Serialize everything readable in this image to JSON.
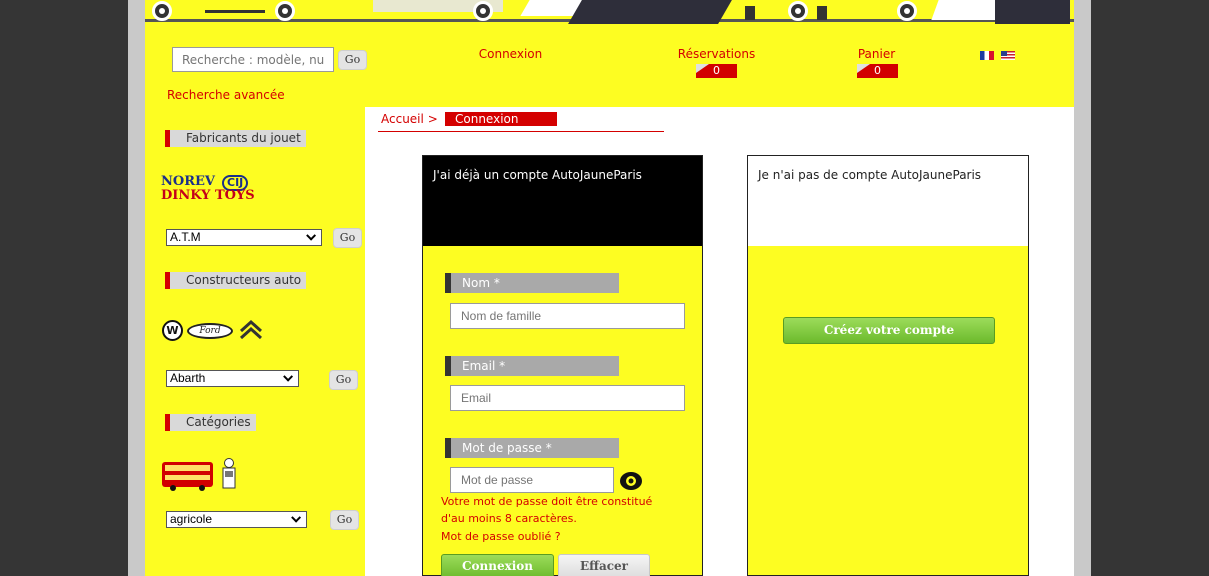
{
  "header": {
    "search": {
      "placeholder": "Recherche : modèle, nume",
      "go_label": "Go"
    },
    "advanced_search": "Recherche avancée",
    "nav": {
      "login": "Connexion",
      "reservations": {
        "label": "Réservations",
        "count": "0"
      },
      "cart": {
        "label": "Panier",
        "count": "0"
      }
    },
    "languages": [
      "fr-flag-icon",
      "us-flag-icon"
    ]
  },
  "sidebar": {
    "manufacturers": {
      "title": "Fabricants du jouet",
      "logo_norev": "NOREV",
      "logo_cij": "CIJ",
      "logo_dinky": "DINKY TOYS",
      "select_value": "A.T.M",
      "go_label": "Go"
    },
    "car_makers": {
      "title": "Constructeurs auto",
      "select_value": "Abarth",
      "go_label": "Go",
      "logos": [
        "volkswagen-logo-icon",
        "ford-logo-icon",
        "citroen-logo-icon"
      ]
    },
    "categories": {
      "title": "Catégories",
      "select_value": "agricole",
      "go_label": "Go",
      "icons": [
        "bus-icon",
        "fuel-pump-icon"
      ]
    }
  },
  "breadcrumb": {
    "home": "Accueil",
    "separator": ">",
    "current": "Connexion"
  },
  "login_panel": {
    "title": "J'ai déjà un compte AutoJauneParis",
    "name_label": "Nom *",
    "name_placeholder": "Nom de famille",
    "email_label": "Email *",
    "email_placeholder": "Email",
    "password_label": "Mot de passe *",
    "password_placeholder": "Mot de passe",
    "password_hint_1": "Votre mot de passe doit être constitué",
    "password_hint_2": "d'au moins 8 caractères.",
    "forgot_password": "Mot de passe oublié ?",
    "submit_label": "Connexion",
    "reset_label": "Effacer"
  },
  "register_panel": {
    "title": "Je n'ai pas de compte AutoJauneParis",
    "create_label": "Créez votre compte"
  },
  "colors": {
    "accent_red": "#d40000",
    "brand_yellow": "#fdfd22",
    "button_green": "#7ec63e"
  }
}
